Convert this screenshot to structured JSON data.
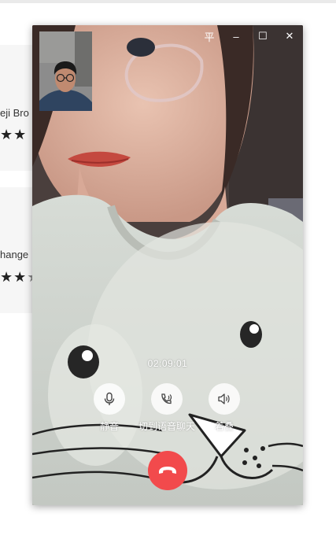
{
  "background": {
    "card1_name": "eji Bro",
    "card1_stars": "★★",
    "card2_name": "hange",
    "card2_stars": "★★",
    "card2_grey_star": "★"
  },
  "call": {
    "timer": "02:09:01",
    "controls": {
      "mute_label": "静音",
      "voice_label": "切到语音聊天",
      "speaker_label": "着叠"
    },
    "window_controls": {
      "pin": "平",
      "minimize": "–",
      "maximize": "☐",
      "close": "✕"
    }
  },
  "colors": {
    "hangup": "#f24a4c",
    "button_bg": "#ffffff"
  }
}
